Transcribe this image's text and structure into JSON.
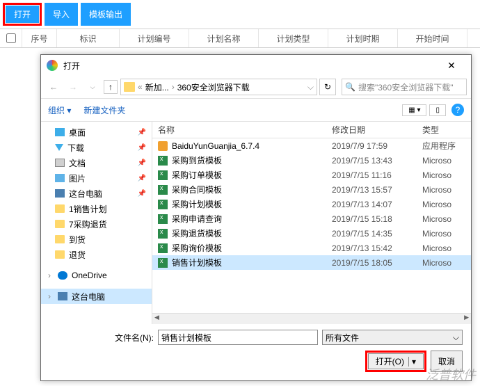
{
  "toolbar": {
    "open": "打开",
    "import": "导入",
    "export": "模板输出"
  },
  "table": {
    "seq": "序号",
    "mark": "标识",
    "plan_no": "计划编号",
    "plan_name": "计划名称",
    "plan_type": "计划类型",
    "plan_time": "计划时期",
    "start_time": "开始时间"
  },
  "dialog": {
    "title": "打开",
    "crumb1": "新加...",
    "crumb2": "360安全浏览器下载",
    "search_placeholder": "搜索\"360安全浏览器下载\"",
    "organize": "组织",
    "new_folder": "新建文件夹",
    "col_name": "名称",
    "col_date": "修改日期",
    "col_type": "类型",
    "filename_label": "文件名(N):",
    "filename_value": "销售计划模板",
    "filter": "所有文件",
    "btn_open": "打开(O)",
    "btn_cancel": "取消"
  },
  "tree": {
    "desktop": "桌面",
    "downloads": "下载",
    "documents": "文档",
    "pictures": "图片",
    "this_pc": "这台电脑",
    "f1": "1销售计划",
    "f2": "7采购退货",
    "f3": "到货",
    "f4": "退货",
    "onedrive": "OneDrive",
    "this_pc2": "这台电脑"
  },
  "files": [
    {
      "name": "BaiduYunGuanjia_6.7.4",
      "date": "2019/7/9 17:59",
      "type": "应用程序",
      "icon": "exe",
      "sel": false
    },
    {
      "name": "采购到货模板",
      "date": "2019/7/15 13:43",
      "type": "Microso",
      "icon": "xls",
      "sel": false
    },
    {
      "name": "采购订单模板",
      "date": "2019/7/15 11:16",
      "type": "Microso",
      "icon": "xls",
      "sel": false
    },
    {
      "name": "采购合同模板",
      "date": "2019/7/13 15:57",
      "type": "Microso",
      "icon": "xls",
      "sel": false
    },
    {
      "name": "采购计划模板",
      "date": "2019/7/13 14:07",
      "type": "Microso",
      "icon": "xls",
      "sel": false
    },
    {
      "name": "采购申请查询",
      "date": "2019/7/15 15:18",
      "type": "Microso",
      "icon": "xls",
      "sel": false
    },
    {
      "name": "采购退货模板",
      "date": "2019/7/15 14:35",
      "type": "Microso",
      "icon": "xls",
      "sel": false
    },
    {
      "name": "采购询价模板",
      "date": "2019/7/13 15:42",
      "type": "Microso",
      "icon": "xls",
      "sel": false
    },
    {
      "name": "销售计划模板",
      "date": "2019/7/15 18:05",
      "type": "Microso",
      "icon": "xls",
      "sel": true
    }
  ],
  "watermark": "泛普软件"
}
